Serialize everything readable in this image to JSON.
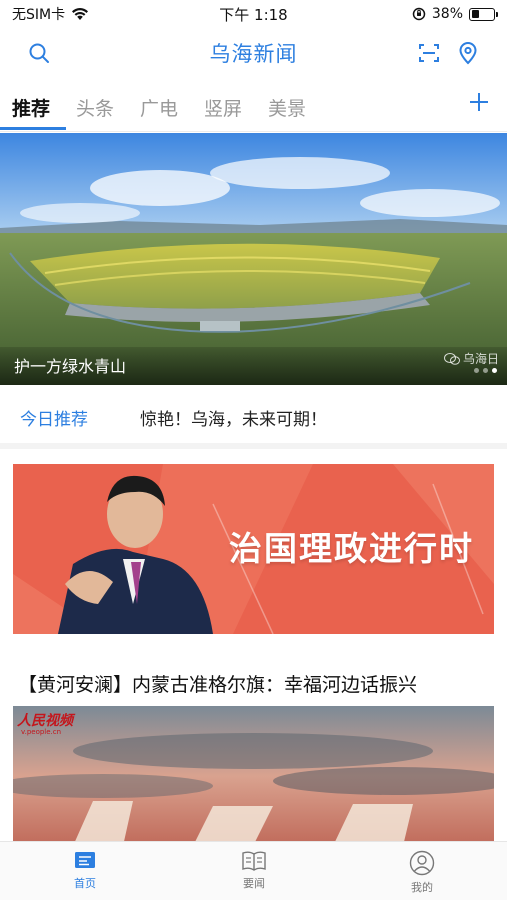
{
  "status_bar": {
    "carrier": "无SIM卡",
    "time": "下午 1:18",
    "battery_percent": "38%",
    "battery_level": 0.38
  },
  "header": {
    "title": "乌海新闻",
    "left_icon": "search-icon",
    "right_icons": [
      "scan-icon",
      "location-pin-icon"
    ]
  },
  "tabs": {
    "items": [
      "推荐",
      "头条",
      "广电",
      "竖屏",
      "美景"
    ],
    "active_index": 0,
    "add_icon": "plus-icon"
  },
  "banner": {
    "caption": "护一方绿水青山",
    "watermark": "乌海日",
    "slide_count": 3,
    "active_slide": 2
  },
  "today": {
    "label": "今日推荐",
    "headline": "惊艳！乌海，未来可期！"
  },
  "promo": {
    "title": "治国理政进行时"
  },
  "article": {
    "title": "【黄河安澜】内蒙古准格尔旗：幸福河边话振兴",
    "logo": "人民视频",
    "logo_sub": "v.people.cn"
  },
  "bottom_nav": {
    "items": [
      {
        "label": "首页",
        "icon": "home-icon"
      },
      {
        "label": "要闻",
        "icon": "book-icon"
      },
      {
        "label": "我的",
        "icon": "user-icon"
      }
    ],
    "active_index": 0
  },
  "colors": {
    "accent": "#2d7fe0",
    "promo_bg": "#e9624e"
  }
}
